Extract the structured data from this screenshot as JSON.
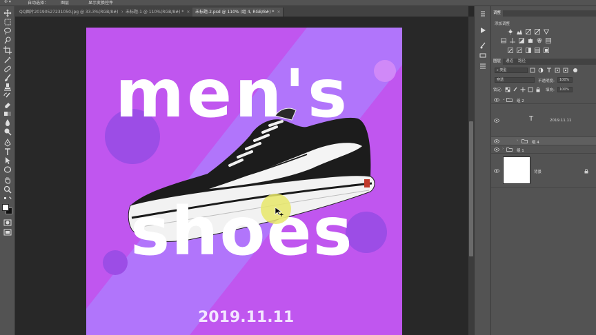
{
  "options_bar": {
    "auto_select_label": "自动选择：",
    "auto_select_value": "图层",
    "show_transform_label": "显示变换控件"
  },
  "tabs": [
    {
      "label": "QQ图片20190527231050.jpg @ 33.3%(RGB/8#)",
      "close": "×",
      "active": false
    },
    {
      "label": "未标题-1 @ 110%(RGB/8#) *",
      "close": "×",
      "active": false
    },
    {
      "label": "未标题-2.psd @ 110% (组 4, RGB/8#) *",
      "close": "×",
      "active": true
    }
  ],
  "toolbar": {
    "icons": [
      "move-icon",
      "marquee-icon",
      "lasso-icon",
      "quick-select-icon",
      "crop-icon",
      "eyedropper-icon",
      "healing-brush-icon",
      "brush-icon",
      "clone-stamp-icon",
      "history-brush-icon",
      "eraser-icon",
      "gradient-icon",
      "blur-icon",
      "dodge-icon",
      "pen-icon",
      "type-icon",
      "path-select-icon",
      "shape-icon",
      "hand-icon",
      "zoom-icon"
    ]
  },
  "artwork": {
    "line1": "men's",
    "line2": "shoes",
    "date": "2019.11.11",
    "background_color": "#c056ef",
    "stripe_color": "#b175fb",
    "circle_color": "#9c4de6",
    "text_color": "#ffffff"
  },
  "adjustments_panel": {
    "tab": "调整",
    "add_label": "添加调整"
  },
  "layers_panel": {
    "tabs": [
      "图层",
      "通道",
      "路径"
    ],
    "filter_type": "类型",
    "blend_mode": "穿透",
    "opacity_label": "不透明度:",
    "opacity_value": "100%",
    "lock_label": "锁定:",
    "fill_label": "填充:",
    "fill_value": "100%",
    "layers": [
      {
        "name": "组 2",
        "kind": "group",
        "expanded": true,
        "selected": false
      },
      {
        "name": "2019.11.11",
        "kind": "text",
        "selected": false
      },
      {
        "name": "组 4",
        "kind": "group",
        "expanded": false,
        "selected": true
      },
      {
        "name": "组 1",
        "kind": "group",
        "expanded": false,
        "selected": false
      },
      {
        "name": "背景",
        "kind": "background",
        "selected": false
      }
    ]
  }
}
